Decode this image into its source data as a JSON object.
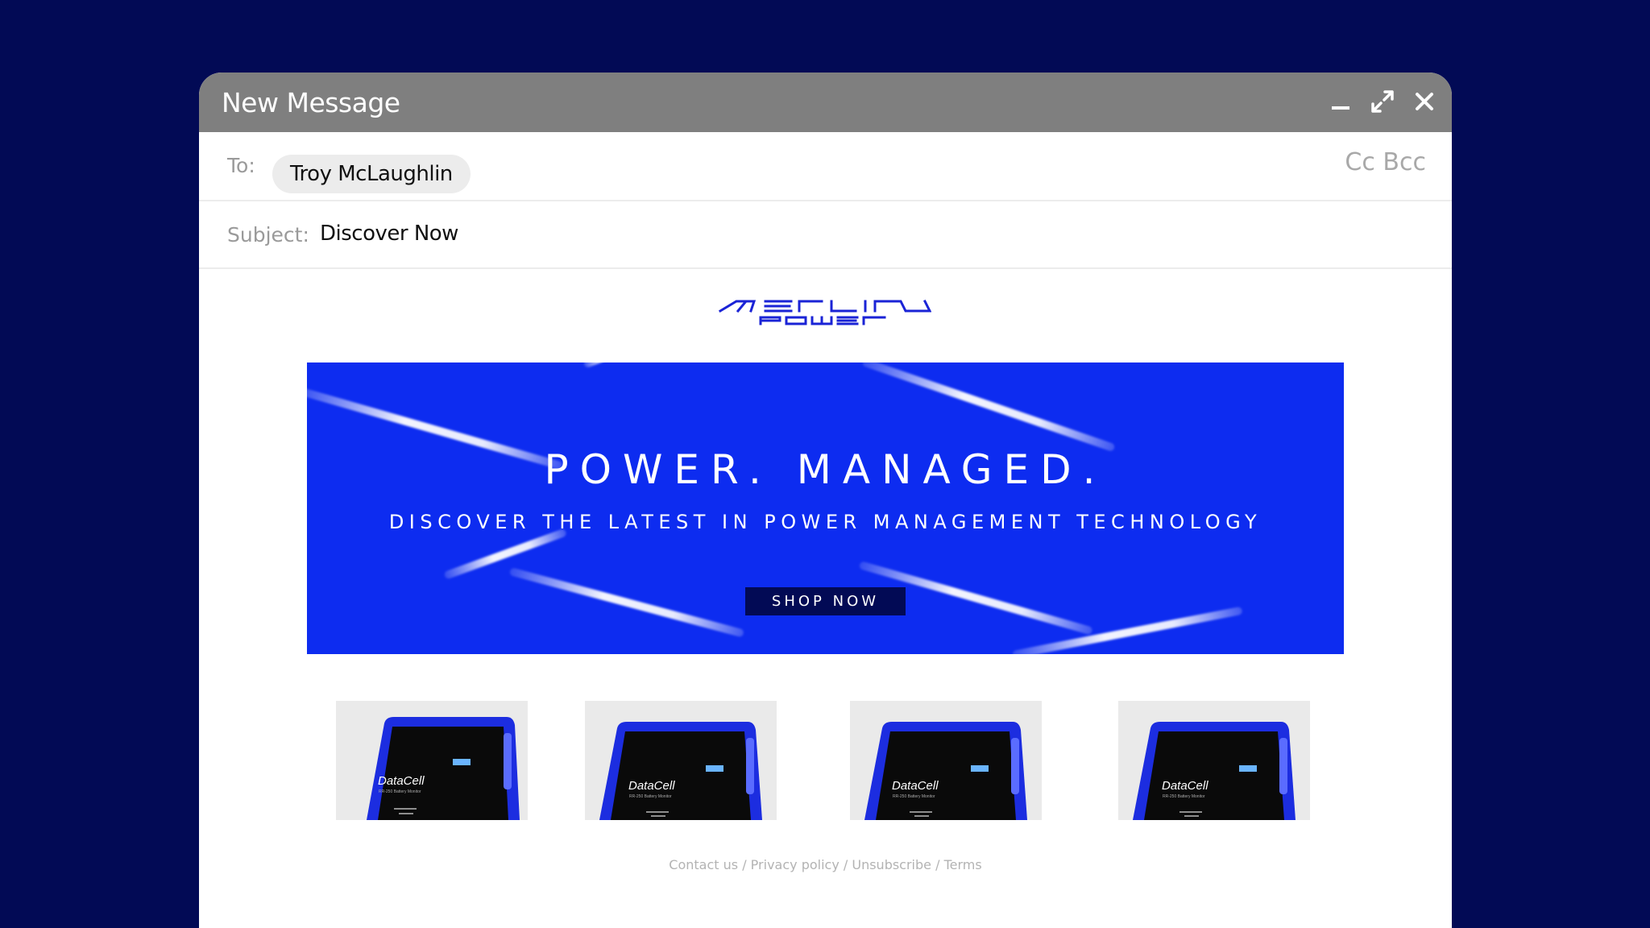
{
  "window": {
    "title": "New Message",
    "controls": {
      "minimize": "minimize-icon",
      "maximize": "expand-icon",
      "close": "close-icon"
    }
  },
  "to": {
    "label": "To:",
    "recipient": "Troy McLaughlin",
    "cc_label": "Cc",
    "bcc_label": "Bcc"
  },
  "subject": {
    "label": "Subject:",
    "value": "Discover Now"
  },
  "email": {
    "logo_text": "MERLIN POWER",
    "banner": {
      "headline": "POWER. MANAGED.",
      "subheadline": "DISCOVER THE LATEST IN POWER MANAGEMENT TECHNOLOGY",
      "cta_label": "SHOP NOW"
    },
    "products": [
      {
        "name": "DataCell",
        "tagline": "RR-250 Battery Monitor"
      },
      {
        "name": "DataCell",
        "tagline": "RR-250 Battery Monitor"
      },
      {
        "name": "DataCell",
        "tagline": "RR-250 Battery Monitor"
      },
      {
        "name": "DataCell",
        "tagline": "RR-250 Battery Monitor"
      }
    ],
    "footer": {
      "links": [
        "Contact us",
        "Privacy policy",
        "Unsubscribe",
        "Terms"
      ],
      "separator": " / "
    }
  },
  "colors": {
    "background": "#020a55",
    "titlebar": "#7f7f7f",
    "banner": "#0d2cf0",
    "brand_blue": "#1a23d6",
    "cta": "#020a55"
  }
}
